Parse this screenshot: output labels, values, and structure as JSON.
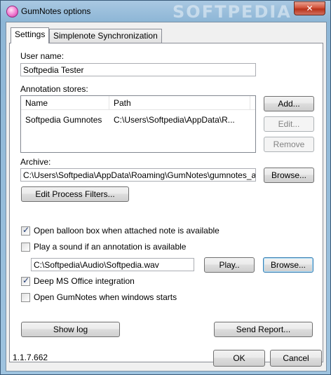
{
  "window": {
    "title": "GumNotes options",
    "close_glyph": "✕",
    "watermark": "SOFTPEDIA",
    "icon": "gumnotes-app-icon"
  },
  "tabs": [
    {
      "label": "Settings",
      "active": true
    },
    {
      "label": "Simplenote Synchronization",
      "active": false
    }
  ],
  "settings": {
    "user_name_label": "User name:",
    "user_name_value": "Softpedia Tester",
    "annotation_stores_label": "Annotation stores:",
    "stores_table": {
      "columns": [
        "Name",
        "Path"
      ],
      "rows": [
        {
          "name": "Softpedia Gumnotes",
          "path": "C:\\Users\\Softpedia\\AppData\\R..."
        }
      ]
    },
    "add_button": "Add...",
    "edit_button": "Edit...",
    "remove_button": "Remove",
    "archive_label": "Archive:",
    "archive_value": "C:\\Users\\Softpedia\\AppData\\Roaming\\GumNotes\\gumnotes_archive",
    "archive_browse_button": "Browse...",
    "edit_filters_button": "Edit Process Filters...",
    "options": [
      {
        "label": "Open balloon box when attached note is available",
        "checked": true
      },
      {
        "label": "Play a sound if an annotation is available",
        "checked": false
      }
    ],
    "sound_file_value": "C:\\Softpedia\\Audio\\Softpedia.wav",
    "play_button": "Play..",
    "sound_browse_button": "Browse...",
    "options2": [
      {
        "label": "Deep MS Office integration",
        "checked": true
      },
      {
        "label": "Open GumNotes when windows starts",
        "checked": false
      }
    ],
    "show_log_button": "Show log",
    "send_report_button": "Send Report..."
  },
  "footer": {
    "version": "1.1.7.662",
    "ok_button": "OK",
    "cancel_button": "Cancel"
  },
  "colors": {
    "titlebar": "#8db6d6",
    "close": "#c8412a",
    "check": "#1f3b73"
  }
}
